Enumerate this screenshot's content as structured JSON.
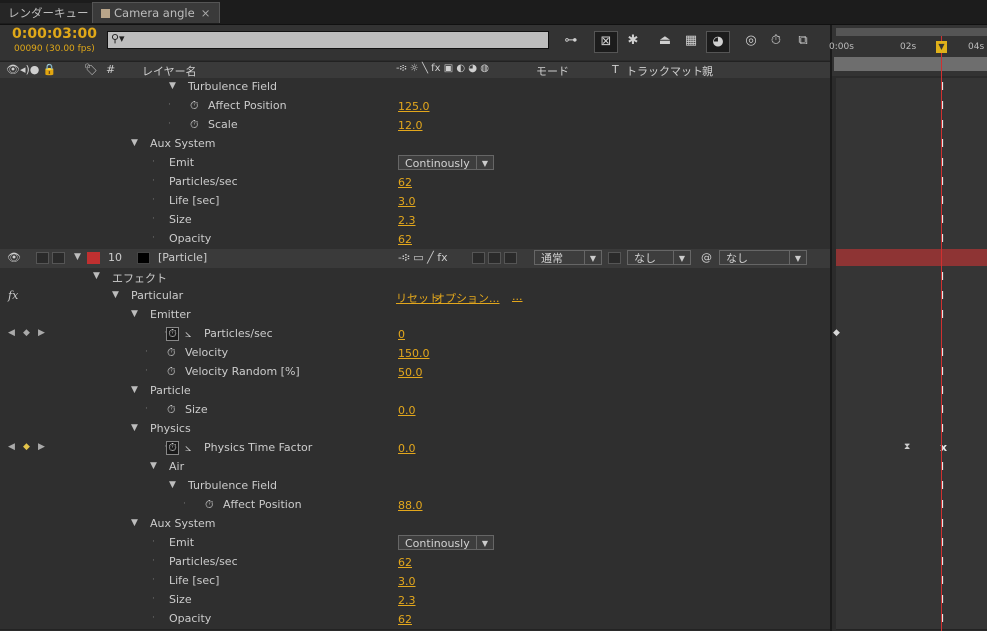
{
  "tabs": [
    {
      "label": "レンダーキュー"
    },
    {
      "label": "Camera angle",
      "close": "×"
    }
  ],
  "header": {
    "timecode": "0:00:03:00",
    "fps": "00090 (30.00 fps)",
    "search_placeholder": ""
  },
  "columns": {
    "layer_name": "レイヤー名",
    "number": "#",
    "mode": "モード",
    "t": "T",
    "track_matte": "トラックマット",
    "parent": "親",
    "switch_icons": "-፨ ☼ ╲ fx ▣ ◐ ◕ ◍"
  },
  "timeline": {
    "ticks": [
      "0:00s",
      "02s",
      "04s"
    ]
  },
  "rows": [
    {
      "indent": 188,
      "label": "Turbulence Field",
      "tri": true
    },
    {
      "indent": 208,
      "label": "Affect Position",
      "stop": true,
      "value": "125.0"
    },
    {
      "indent": 208,
      "label": "Scale",
      "stop": true,
      "value": "12.0"
    },
    {
      "indent": 150,
      "label": "Aux System",
      "tri": true
    },
    {
      "indent": 169,
      "label": "Emit",
      "dropdown": "Continously"
    },
    {
      "indent": 169,
      "label": "Particles/sec",
      "value": "62"
    },
    {
      "indent": 169,
      "label": "Life [sec]",
      "value": "3.0"
    },
    {
      "indent": 169,
      "label": "Size",
      "value": "2.3"
    },
    {
      "indent": 169,
      "label": "Opacity",
      "value": "62"
    },
    {
      "layer": true,
      "number": "10",
      "name": "[Particle]",
      "mode": "通常",
      "matte": "なし",
      "parent": "なし"
    },
    {
      "indent": 112,
      "label": "エフェクト",
      "tri": true
    },
    {
      "indent": 131,
      "label": "Particular",
      "tri": true,
      "fx": true,
      "reset": "リセット",
      "options": "オプション...",
      "more": "..."
    },
    {
      "indent": 150,
      "label": "Emitter",
      "tri": true
    },
    {
      "indent": 204,
      "label": "Particles/sec",
      "stopbox": true,
      "graph": true,
      "value": "0",
      "kfnav": true
    },
    {
      "indent": 185,
      "label": "Velocity",
      "stop": true,
      "value": "150.0"
    },
    {
      "indent": 185,
      "label": "Velocity Random [%]",
      "stop": true,
      "value": "50.0"
    },
    {
      "indent": 150,
      "label": "Particle",
      "tri": true
    },
    {
      "indent": 185,
      "label": "Size",
      "stop": true,
      "value": "0.0"
    },
    {
      "indent": 150,
      "label": "Physics",
      "tri": true
    },
    {
      "indent": 204,
      "label": "Physics Time Factor",
      "stopbox": true,
      "graph": true,
      "value": "0.0",
      "kfnav": true,
      "kfon": true
    },
    {
      "indent": 169,
      "label": "Air",
      "tri": true
    },
    {
      "indent": 188,
      "label": "Turbulence Field",
      "tri": true
    },
    {
      "indent": 223,
      "label": "Affect Position",
      "stop": true,
      "value": "88.0"
    },
    {
      "indent": 150,
      "label": "Aux System",
      "tri": true
    },
    {
      "indent": 169,
      "label": "Emit",
      "dropdown": "Continously"
    },
    {
      "indent": 169,
      "label": "Particles/sec",
      "value": "62"
    },
    {
      "indent": 169,
      "label": "Life [sec]",
      "value": "3.0"
    },
    {
      "indent": 169,
      "label": "Size",
      "value": "2.3"
    },
    {
      "indent": 169,
      "label": "Opacity",
      "value": "62"
    }
  ],
  "colors": {
    "accent": "#e3a71c",
    "cti": "#d03030",
    "layer_bar": "#8e3434",
    "label_red": "#c03030"
  }
}
